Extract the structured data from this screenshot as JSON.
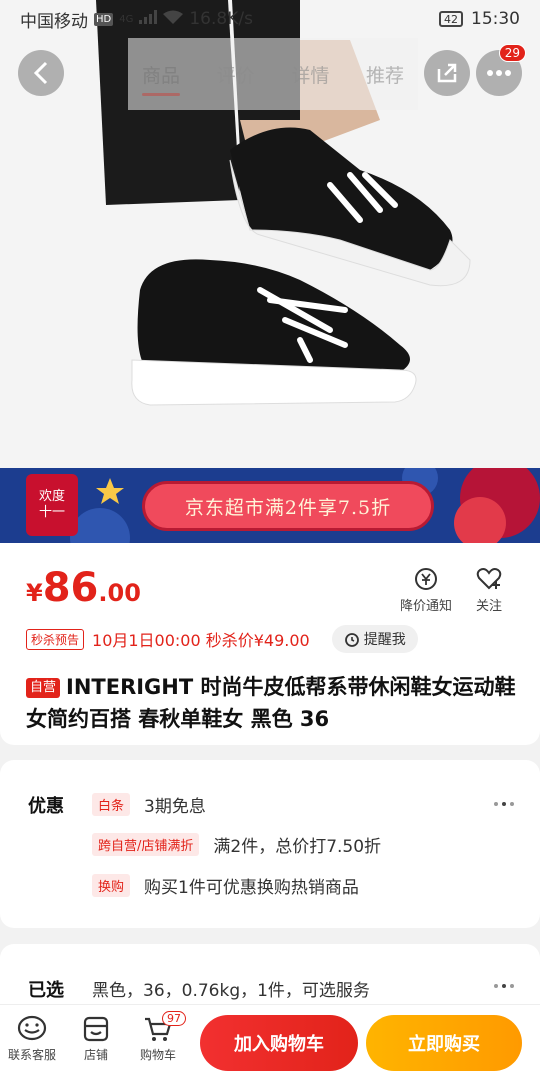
{
  "status_bar": {
    "carrier": "中国移动",
    "hd": "HD",
    "network": "4G",
    "speed": "16.8K/s",
    "battery": "42",
    "time": "15:30"
  },
  "top_nav": {
    "tabs": [
      {
        "label": "商品",
        "active": true
      },
      {
        "label": "评价",
        "active": false
      },
      {
        "label": "详情",
        "active": false
      },
      {
        "label": "推荐",
        "active": false
      }
    ],
    "more_badge": "29"
  },
  "promo": {
    "logo_line1": "欢度",
    "logo_line2": "十一",
    "text": "京东超市满2件享7.5折"
  },
  "price": {
    "currency": "¥",
    "integer": "86",
    "decimal": ".00"
  },
  "actions": {
    "notify_label": "降价通知",
    "follow_label": "关注"
  },
  "flash_sale": {
    "tag": "秒杀预告",
    "text": "10月1日00:00 秒杀价¥49.00",
    "remind_label": "提醒我"
  },
  "product": {
    "self_tag": "自营",
    "title": "INTERIGHT 时尚牛皮低帮系带休闲鞋女运动鞋女简约百搭 春秋单鞋女 黑色 36"
  },
  "offers": {
    "label": "优惠",
    "items": [
      {
        "tag": "白条",
        "text": "3期免息"
      },
      {
        "tag": "跨自营/店铺满折",
        "text": "满2件，总价打7.50折"
      },
      {
        "tag": "换购",
        "text": "购买1件可优惠换购热销商品"
      }
    ]
  },
  "selected": {
    "label": "已选",
    "text": "黑色，36，0.76kg，1件，可选服务"
  },
  "bottom_bar": {
    "contact_label": "联系客服",
    "shop_label": "店铺",
    "cart_label": "购物车",
    "cart_badge": "97",
    "add_cart_label": "加入购物车",
    "buy_now_label": "立即购买"
  },
  "colors": {
    "accent": "#e2231a",
    "buy": "#ff9a00"
  }
}
